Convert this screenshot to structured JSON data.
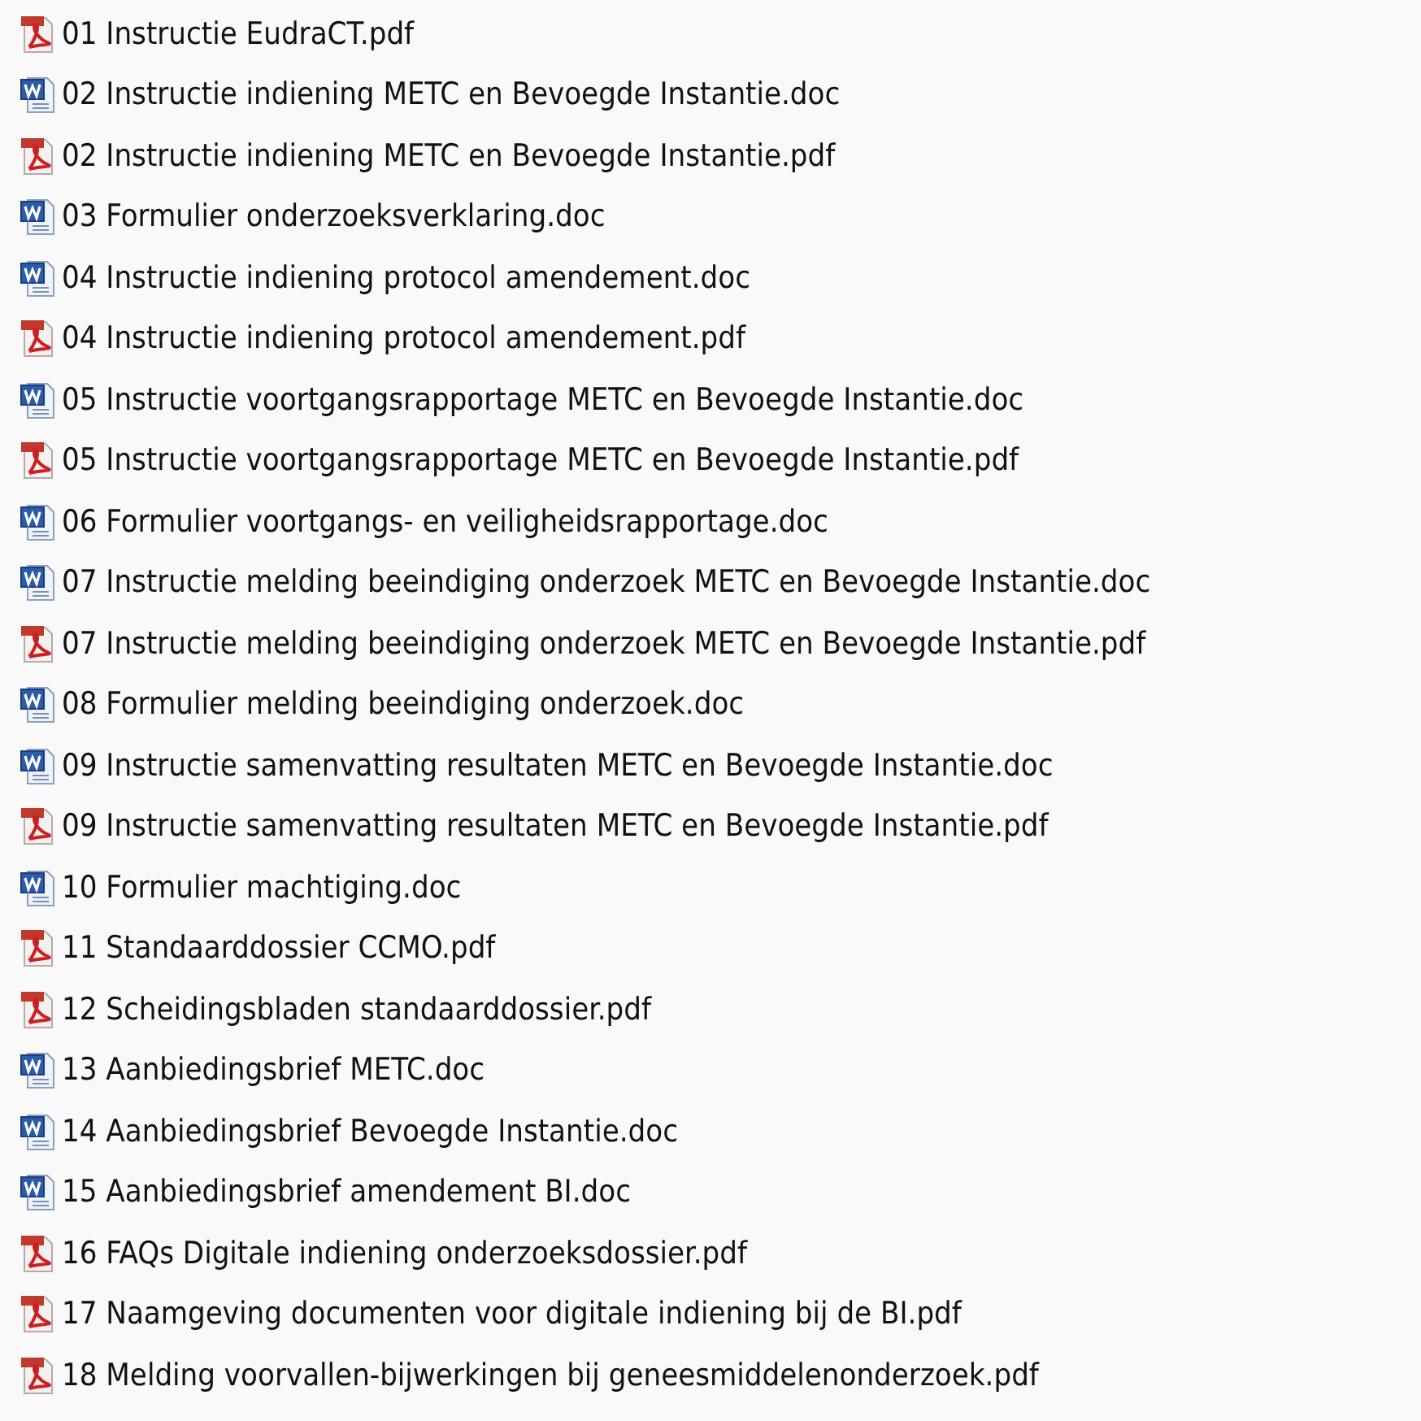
{
  "files": [
    {
      "kind": "pdf",
      "name": "01 Instructie EudraCT.pdf"
    },
    {
      "kind": "doc",
      "name": "02 Instructie indiening METC en Bevoegde Instantie.doc"
    },
    {
      "kind": "pdf",
      "name": "02 Instructie indiening METC en Bevoegde Instantie.pdf"
    },
    {
      "kind": "doc",
      "name": "03 Formulier onderzoeksverklaring.doc"
    },
    {
      "kind": "doc",
      "name": "04 Instructie indiening protocol amendement.doc"
    },
    {
      "kind": "pdf",
      "name": "04 Instructie indiening protocol amendement.pdf"
    },
    {
      "kind": "doc",
      "name": "05 Instructie voortgangsrapportage METC en Bevoegde Instantie.doc"
    },
    {
      "kind": "pdf",
      "name": "05 Instructie voortgangsrapportage METC en Bevoegde Instantie.pdf"
    },
    {
      "kind": "doc",
      "name": "06 Formulier voortgangs- en veiligheidsrapportage.doc"
    },
    {
      "kind": "doc",
      "name": "07 Instructie melding beeindiging onderzoek METC en Bevoegde Instantie.doc"
    },
    {
      "kind": "pdf",
      "name": "07 Instructie melding beeindiging onderzoek METC en Bevoegde Instantie.pdf"
    },
    {
      "kind": "doc",
      "name": "08 Formulier melding beeindiging onderzoek.doc"
    },
    {
      "kind": "doc",
      "name": "09 Instructie samenvatting resultaten METC en Bevoegde Instantie.doc"
    },
    {
      "kind": "pdf",
      "name": "09 Instructie samenvatting resultaten METC en Bevoegde Instantie.pdf"
    },
    {
      "kind": "doc",
      "name": "10 Formulier machtiging.doc"
    },
    {
      "kind": "pdf",
      "name": "11 Standaarddossier CCMO.pdf"
    },
    {
      "kind": "pdf",
      "name": "12 Scheidingsbladen standaarddossier.pdf"
    },
    {
      "kind": "doc",
      "name": "13 Aanbiedingsbrief METC.doc"
    },
    {
      "kind": "doc",
      "name": "14 Aanbiedingsbrief Bevoegde Instantie.doc"
    },
    {
      "kind": "doc",
      "name": "15 Aanbiedingsbrief amendement BI.doc"
    },
    {
      "kind": "pdf",
      "name": "16 FAQs Digitale indiening onderzoeksdossier.pdf"
    },
    {
      "kind": "pdf",
      "name": "17 Naamgeving documenten voor digitale indiening bij de BI.pdf"
    },
    {
      "kind": "pdf",
      "name": "18 Melding voorvallen-bijwerkingen bij geneesmiddelenonderzoek.pdf"
    }
  ]
}
